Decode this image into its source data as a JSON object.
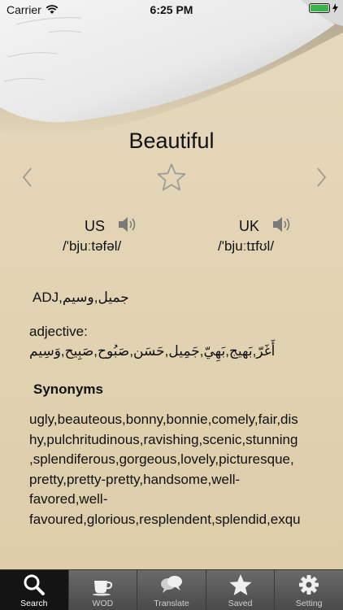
{
  "status_bar": {
    "carrier": "Carrier",
    "time": "6:25 PM",
    "battery_level": 1.0,
    "battery_color": "#3bb34a"
  },
  "word": {
    "title": "Beautiful",
    "favorite_icon": "star-outline-icon",
    "prev_icon": "chevron-left-icon",
    "next_icon": "chevron-right-icon"
  },
  "pronunciation": {
    "us": {
      "label": "US",
      "ipa": "/'bjuːtəfəl/",
      "icon": "speaker-icon"
    },
    "uk": {
      "label": "UK",
      "ipa": "/'bjuːtɪfʊl/",
      "icon": "speaker-icon"
    }
  },
  "meaning": {
    "short": "ADJ,جميل,وسيم",
    "pos_label": "adjective:",
    "arabic": "أَغَرّ,بَهيج,بَهِيّ,جَمِيل,حَسَن,صَبُوح,صَبِيح,وَسِيم"
  },
  "synonyms": {
    "heading": "Synonyms",
    "lines": [
      "ugly,beauteous,bonny,bonnie,comely,fair,dis",
      "hy,pulchritudinous,ravishing,scenic,stunning",
      ",splendiferous,gorgeous,lovely,picturesque,",
      "pretty,pretty-pretty,handsome,well-",
      "favored,well-",
      "favoured,glorious,resplendent,splendid,exqu"
    ]
  },
  "tabbar": {
    "active": "search",
    "tabs": [
      {
        "id": "search",
        "label": "Search",
        "icon": "search-icon"
      },
      {
        "id": "wod",
        "label": "WOD",
        "icon": "coffee-cup-icon"
      },
      {
        "id": "translate",
        "label": "Translate",
        "icon": "speech-bubbles-icon"
      },
      {
        "id": "saved",
        "label": "Saved",
        "icon": "star-icon"
      },
      {
        "id": "setting",
        "label": "Setting",
        "icon": "gear-icon"
      }
    ]
  }
}
